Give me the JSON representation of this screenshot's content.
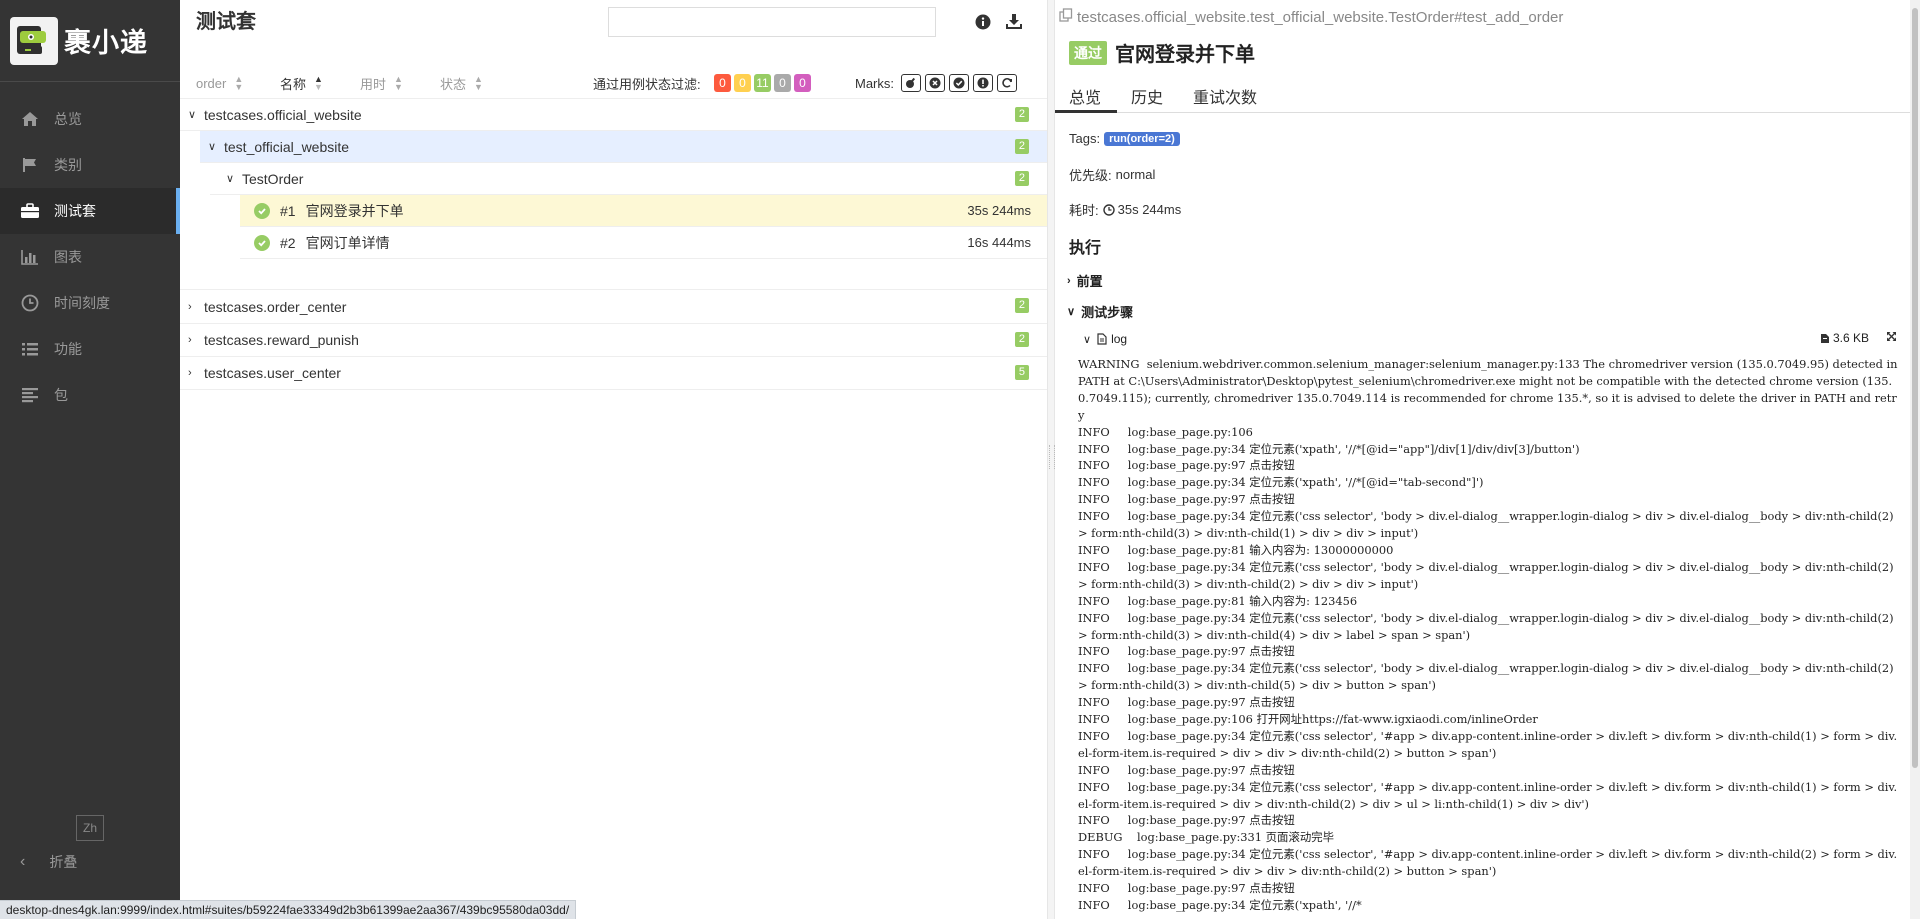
{
  "sidebar": {
    "logo_text": "裹小递",
    "items": [
      {
        "label": "总览",
        "icon": "home-icon"
      },
      {
        "label": "类别",
        "icon": "flag-icon"
      },
      {
        "label": "测试套",
        "icon": "briefcase-icon",
        "active": true
      },
      {
        "label": "图表",
        "icon": "bar-chart-icon"
      },
      {
        "label": "时间刻度",
        "icon": "clock-icon"
      },
      {
        "label": "功能",
        "icon": "list-icon"
      },
      {
        "label": "包",
        "icon": "align-left-icon"
      }
    ],
    "lang": "Zh",
    "collapse": "折叠"
  },
  "suites": {
    "title": "测试套",
    "search_placeholder": "",
    "sort": [
      {
        "label": "order"
      },
      {
        "label": "名称"
      },
      {
        "label": "用时"
      },
      {
        "label": "状态"
      }
    ],
    "filter_label": "通过用例状态过滤:",
    "filters": [
      {
        "value": "0",
        "color": "#fd5a3e"
      },
      {
        "value": "0",
        "color": "#ffd050"
      },
      {
        "value": "11",
        "color": "#97cc64"
      },
      {
        "value": "0",
        "color": "#aaaaaa"
      },
      {
        "value": "0",
        "color": "#d35ebe"
      }
    ],
    "marks_label": "Marks:",
    "tree": {
      "group1": {
        "name": "testcases.official_website",
        "count": "2"
      },
      "group1_child": {
        "name": "test_official_website",
        "count": "2"
      },
      "group1_class": {
        "name": "TestOrder",
        "count": "2"
      },
      "tests": [
        {
          "order": "#1",
          "name": "官网登录并下单",
          "duration": "35s 244ms"
        },
        {
          "order": "#2",
          "name": "官网订单详情",
          "duration": "16s 444ms"
        }
      ],
      "group2": {
        "name": "testcases.order_center",
        "count": "2"
      },
      "group3": {
        "name": "testcases.reward_punish",
        "count": "2"
      },
      "group4": {
        "name": "testcases.user_center",
        "count": "5"
      }
    }
  },
  "detail": {
    "path": "testcases.official_website.test_official_website.TestOrder#test_add_order",
    "status": "通过",
    "name": "官网登录并下单",
    "tabs": [
      "总览",
      "历史",
      "重试次数"
    ],
    "tags_label": "Tags:",
    "tag": "run(order=2)",
    "severity_label": "优先级:",
    "severity": "normal",
    "duration_label": "耗时:",
    "duration": "35s 244ms",
    "execution_title": "执行",
    "setup_label": "前置",
    "steps_label": "测试步骤",
    "log_label": "log",
    "log_size": "3.6 KB",
    "log_text": "WARNING  selenium.webdriver.common.selenium_manager:selenium_manager.py:133 The chromedriver version (135.0.7049.95) detected in PATH at C:\\Users\\Administrator\\Desktop\\pytest_selenium\\chromedriver.exe might not be compatible with the detected chrome version (135.0.7049.115); currently, chromedriver 135.0.7049.114 is recommended for chrome 135.*, so it is advised to delete the driver in PATH and retry\nINFO     log:base_page.py:106\nINFO     log:base_page.py:34 定位元素('xpath', '//*[@id=\"app\"]/div[1]/div/div[3]/button')\nINFO     log:base_page.py:97 点击按钮\nINFO     log:base_page.py:34 定位元素('xpath', '//*[@id=\"tab-second\"]')\nINFO     log:base_page.py:97 点击按钮\nINFO     log:base_page.py:34 定位元素('css selector', 'body > div.el-dialog__wrapper.login-dialog > div > div.el-dialog__body > div:nth-child(2) > form:nth-child(3) > div:nth-child(1) > div > div > input')\nINFO     log:base_page.py:81 输入内容为: 13000000000\nINFO     log:base_page.py:34 定位元素('css selector', 'body > div.el-dialog__wrapper.login-dialog > div > div.el-dialog__body > div:nth-child(2) > form:nth-child(3) > div:nth-child(2) > div > div > input')\nINFO     log:base_page.py:81 输入内容为: 123456\nINFO     log:base_page.py:34 定位元素('css selector', 'body > div.el-dialog__wrapper.login-dialog > div > div.el-dialog__body > div:nth-child(2) > form:nth-child(3) > div:nth-child(4) > div > label > span > span')\nINFO     log:base_page.py:97 点击按钮\nINFO     log:base_page.py:34 定位元素('css selector', 'body > div.el-dialog__wrapper.login-dialog > div > div.el-dialog__body > div:nth-child(2) > form:nth-child(3) > div:nth-child(5) > div > button > span')\nINFO     log:base_page.py:97 点击按钮\nINFO     log:base_page.py:106 打开网址https://fat-www.igxiaodi.com/inlineOrder\nINFO     log:base_page.py:34 定位元素('css selector', '#app > div.app-content.inline-order > div.left > div.form > div:nth-child(1) > form > div.el-form-item.is-required > div > div > div:nth-child(2) > button > span')\nINFO     log:base_page.py:97 点击按钮\nINFO     log:base_page.py:34 定位元素('css selector', '#app > div.app-content.inline-order > div.left > div.form > div:nth-child(1) > form > div.el-form-item.is-required > div > div:nth-child(2) > div > ul > li:nth-child(1) > div > div')\nINFO     log:base_page.py:97 点击按钮\nDEBUG    log:base_page.py:331 页面滚动完毕\nINFO     log:base_page.py:34 定位元素('css selector', '#app > div.app-content.inline-order > div.left > div.form > div:nth-child(2) > form > div.el-form-item.is-required > div > div > div:nth-child(2) > button > span')\nINFO     log:base_page.py:97 点击按钮\nINFO     log:base_page.py:34 定位元素('xpath', '//*"
  },
  "statusbar": {
    "url": "desktop-dnes4gk.lan:9999/index.html#suites/b59224fae33349d2b3b61399ae2aa367/439bc95580da03dd/"
  },
  "colors": {
    "sidebar_bg": "#343434",
    "passed": "#97cc64",
    "selected_row": "#e6efff",
    "highlight_row": "#fdf8d5",
    "tag_blue": "#4a77d4"
  }
}
